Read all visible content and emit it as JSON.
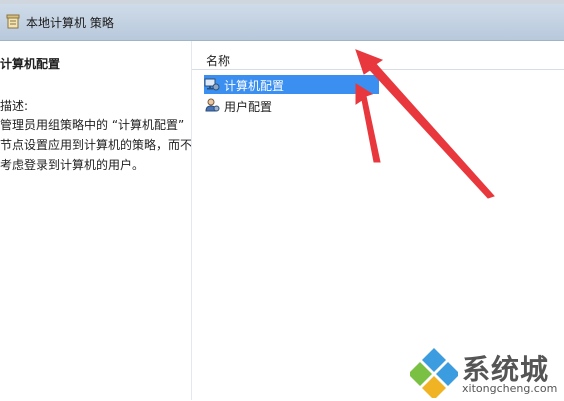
{
  "window": {
    "title": "本地计算机 策略",
    "icon": "policy-scroll-icon"
  },
  "left_pane": {
    "heading": "计算机配置",
    "description_label": "描述:",
    "description_lines": [
      "管理员用组策略中的 “计算机配置”",
      "节点设置应用到计算机的策略，而不",
      "考虑登录到计算机的用户。"
    ]
  },
  "right_pane": {
    "column_header": "名称",
    "items": [
      {
        "label": "计算机配置",
        "icon": "computer-config-icon",
        "selected": true
      },
      {
        "label": "用户配置",
        "icon": "user-config-icon",
        "selected": false
      }
    ]
  },
  "annotations": {
    "arrow_color": "#e8383d",
    "arrow_count": 2
  },
  "watermark": {
    "brand": "系统城",
    "url": "xitongcheng.com",
    "logo": "diamond-logo"
  },
  "colors": {
    "selection": "#3b8ff0",
    "header_bg": "#c4d4e6"
  }
}
